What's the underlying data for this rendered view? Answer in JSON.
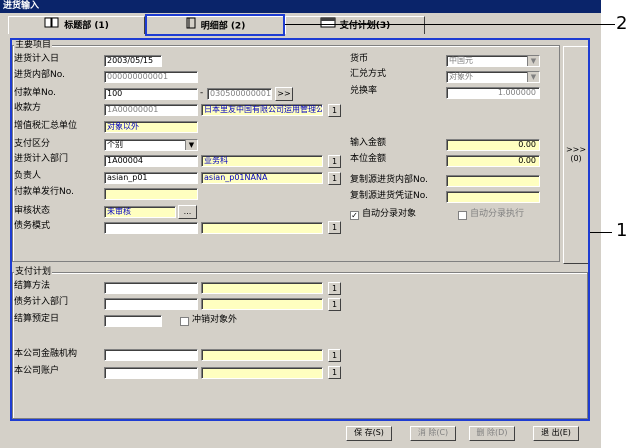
{
  "window": {
    "title": "进货输入"
  },
  "tabs": [
    {
      "label": "标题部 (1)",
      "icon": "book-icon"
    },
    {
      "label": "明细部 (2)",
      "icon": "notebook-icon"
    },
    {
      "label": "支付计划(3)",
      "icon": "window-icon"
    }
  ],
  "main_group": {
    "title": "主要项目",
    "entry_date": {
      "label": "进货计入日",
      "value": "2003/05/15"
    },
    "internal_no": {
      "label": "进货内部No.",
      "value": "000000000001"
    },
    "payment_no": {
      "label": "付款单No.",
      "value": "100",
      "dash": "-",
      "value2": "030500000001",
      "nav": ">>"
    },
    "payee": {
      "label": "收款方",
      "code": "1A00000001",
      "name": "日本里友中国有限公司运用管理公司",
      "btn": "1"
    },
    "vat_unit": {
      "label": "增值税汇总单位",
      "value": "对象以外"
    },
    "pay_type": {
      "label": "支付区分",
      "value": "个别"
    },
    "dept": {
      "label": "进货计入部门",
      "code": "1A00004",
      "name": "业务科",
      "btn": "1"
    },
    "person": {
      "label": "负责人",
      "code": "asian_p01",
      "name": "asian_p01NANA",
      "btn": "1"
    },
    "pay_issue": {
      "label": "付款单发行No."
    },
    "approval": {
      "label": "审核状态",
      "value": "未审核",
      "btn": "..."
    },
    "debt_mode": {
      "label": "债务模式",
      "btn": "1"
    },
    "currency": {
      "label": "货币",
      "value": "中国元"
    },
    "exchange": {
      "label": "汇兑方式",
      "value": "对象外"
    },
    "rate": {
      "label": "兑换率",
      "value": "1.000000"
    },
    "input_amount": {
      "label": "输入金额",
      "value": "0.00"
    },
    "local_amount": {
      "label": "本位金额",
      "value": "0.00"
    },
    "copy_internal": {
      "label": "复制源进货内部No."
    },
    "copy_voucher": {
      "label": "复制源进货凭证No."
    },
    "auto_entry": {
      "label": "自动分录对象",
      "checked": true
    },
    "auto_exec": {
      "label": "自动分录执行",
      "checked": false
    }
  },
  "side_button": {
    "label": ">>> (0)"
  },
  "plan_group": {
    "title": "支付计划",
    "method": {
      "label": "结算方法",
      "btn": "1"
    },
    "debt_dept": {
      "label": "债务计入部门",
      "btn": "1"
    },
    "due_date": {
      "label": "结算预定日"
    },
    "offset": {
      "label": "冲销对象外",
      "checked": false
    },
    "bank": {
      "label": "本公司金融机构",
      "btn": "1"
    },
    "account": {
      "label": "本公司账户",
      "btn": "1"
    }
  },
  "footer": {
    "save": "保 存(S)",
    "clear": "消 除(C)",
    "delete": "删 除(D)",
    "exit": "退 出(E)"
  },
  "callouts": {
    "one": "1",
    "two": "2"
  }
}
